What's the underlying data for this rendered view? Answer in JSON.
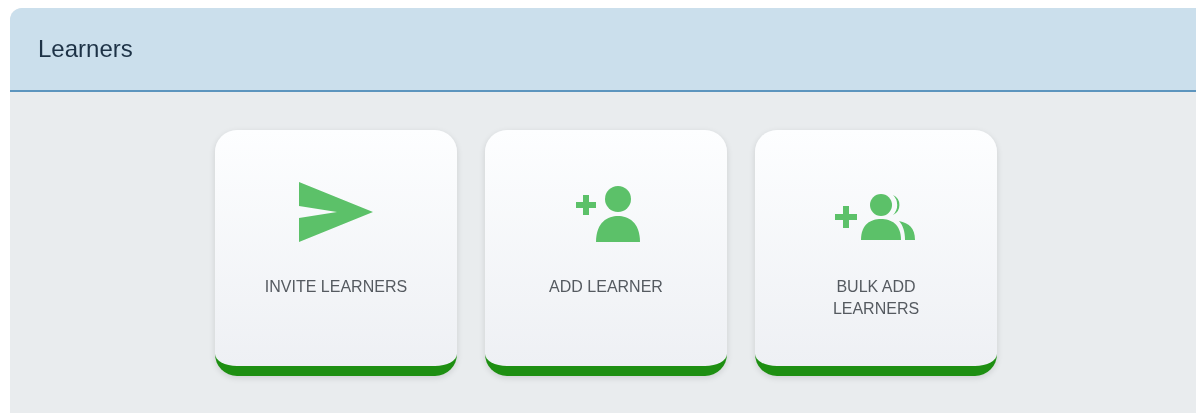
{
  "panel": {
    "title": "Learners"
  },
  "actions": [
    {
      "kind": "invite",
      "label": "INVITE LEARNERS"
    },
    {
      "kind": "add",
      "label": "ADD LEARNER"
    },
    {
      "kind": "bulk",
      "label": "BULK ADD LEARNERS"
    }
  ]
}
